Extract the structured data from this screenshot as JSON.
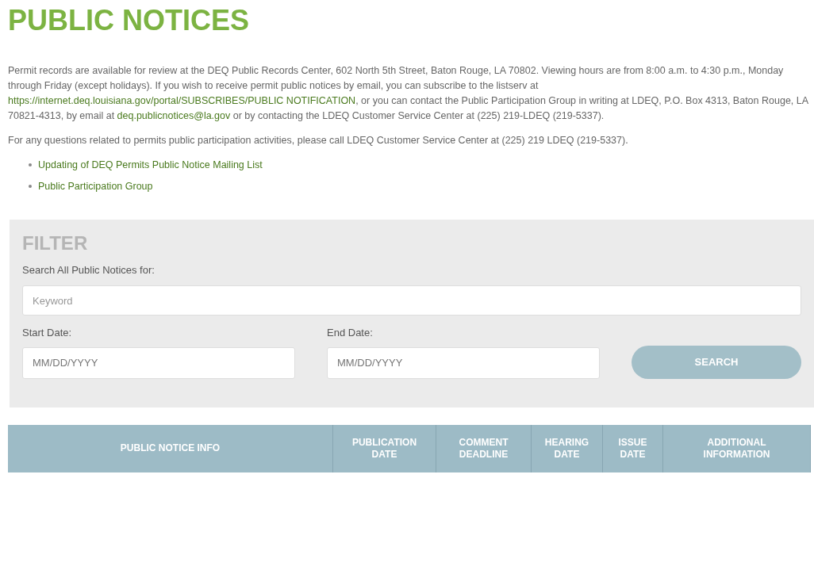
{
  "title": "PUBLIC NOTICES",
  "paragraphs": [
    [
      {
        "kind": "text",
        "text": "Permit records are available for review at the DEQ Public Records Center, 602 North 5th Street, Baton Rouge, LA 70802. Viewing hours are from 8:00 a.m. to 4:30 p.m., Monday through Friday (except holidays). If you wish to receive permit public notices by email, you can subscribe to the listserv at "
      },
      {
        "kind": "link",
        "text": "https://internet.deq.louisiana.gov/portal/SUBSCRIBES/PUBLIC NOTIFICATION"
      },
      {
        "kind": "text",
        "text": ", or you can contact the Public Participation Group in writing at LDEQ, P.O. Box 4313, Baton Rouge, LA 70821-4313, by email at "
      },
      {
        "kind": "link",
        "text": "deq.publicnotices@la.gov"
      },
      {
        "kind": "text",
        "text": " or by contacting the LDEQ Customer Service Center at (225) 219-LDEQ (219-5337)."
      }
    ],
    [
      {
        "kind": "text",
        "text": "For any questions related to permits public participation activities, please call LDEQ Customer Service Center at (225) 219 LDEQ (219-5337)."
      }
    ]
  ],
  "links": [
    "Updating of DEQ Permits Public Notice Mailing List",
    "Public Participation Group"
  ],
  "filter": {
    "heading": "FILTER",
    "search_label": "Search All Public Notices for:",
    "search_placeholder": "Keyword",
    "start_label": "Start Date:",
    "start_placeholder": "MM/DD/YYYY",
    "end_label": "End Date:",
    "end_placeholder": "MM/DD/YYYY",
    "button": "SEARCH"
  },
  "table": {
    "columns": [
      [
        "PUBLIC NOTICE INFO"
      ],
      [
        "PUBLICATION",
        "DATE"
      ],
      [
        "COMMENT",
        "DEADLINE"
      ],
      [
        "HEARING",
        "DATE"
      ],
      [
        "ISSUE",
        "DATE"
      ],
      [
        "ADDITIONAL",
        "INFORMATION"
      ]
    ]
  }
}
